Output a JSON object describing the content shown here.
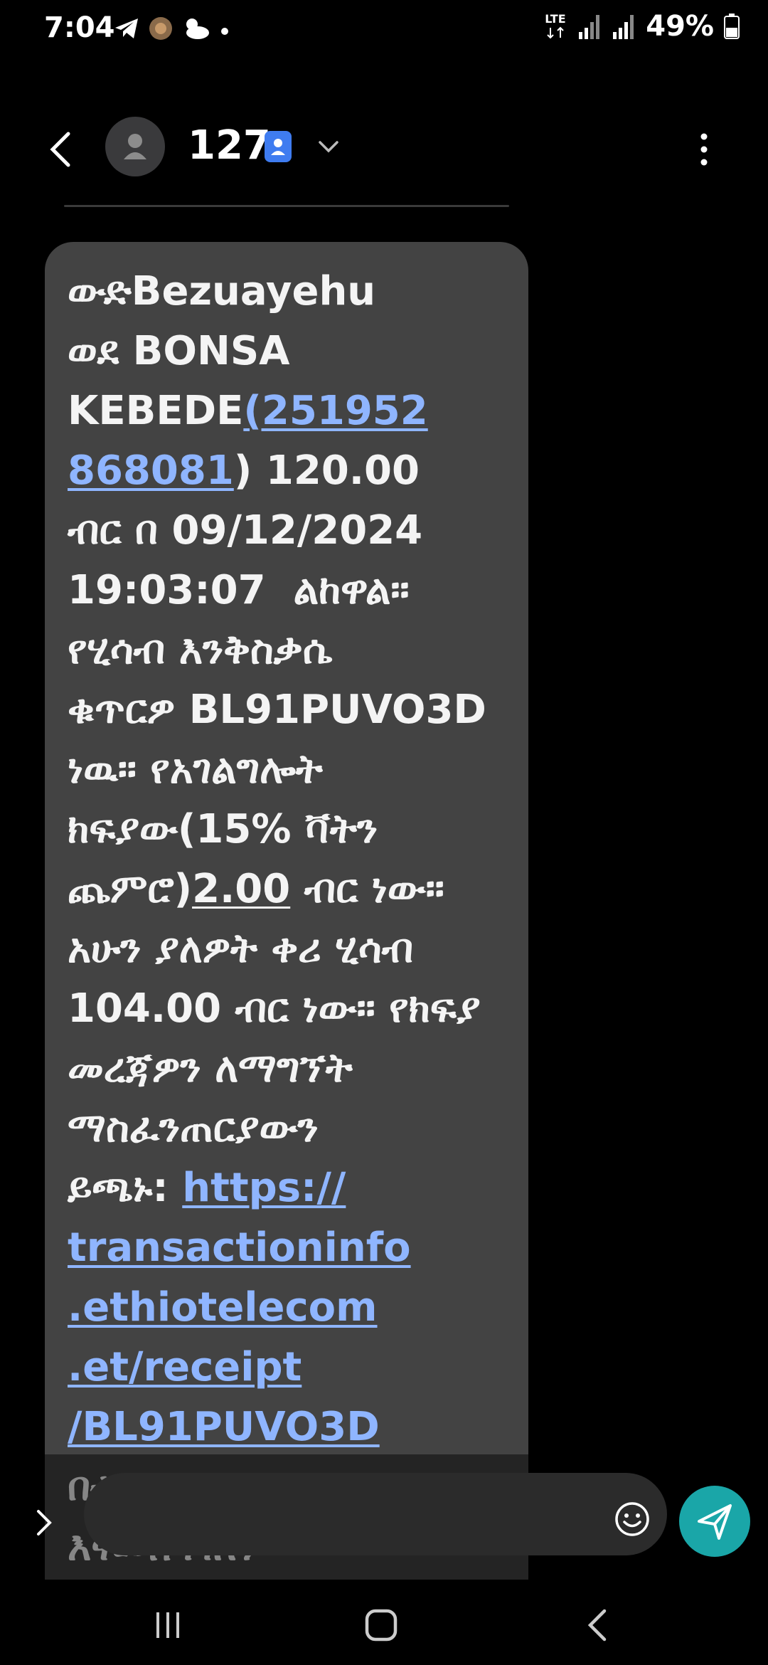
{
  "status_bar": {
    "time": "7:04",
    "network": "LTE",
    "battery": "49%"
  },
  "header": {
    "contact_name": "127",
    "icons": [
      "back-arrow-icon",
      "avatar-icon",
      "contact-badge-icon",
      "chevron-down-icon",
      "more-vert-icon"
    ]
  },
  "message": {
    "segments": [
      {
        "text": "ውድBezuayehu\nወደ BONSA\nKEBEDE",
        "style": "plain"
      },
      {
        "text": "(251952\n868081",
        "style": "link"
      },
      {
        "text": ") 120.00\nብር በ 09/12/2024\n19:03:07  ልከዋል። \nየሂሳብ እንቅስቃሴ\nቁጥርዎ BL91PUVO3D\nነዉ። የአገልግሎት\nክፍያው(15% ቫትን\nጨምሮ)",
        "style": "plain"
      },
      {
        "text": "2.00",
        "style": "underline"
      },
      {
        "text": " ብር ነው። \nአሁን ያለዎት ቀሪ ሂሳብ\n104.00 ብር ነው። የክፍያ\nመረጃዎን ለማግኘት\nማስፈንጠርያውን\nይጫኑ: ",
        "style": "plain"
      },
      {
        "text": "https://\ntransactioninfo\n.ethiotelecom\n.et/receipt\n/BL91PUVO3D",
        "style": "link"
      },
      {
        "text": "\nበቴሌ ብር ስለተገለገሉ\nእናመሰግናለን",
        "style": "plain"
      }
    ]
  },
  "composer": {
    "placeholder": ""
  },
  "nav_bar": {
    "icons": [
      "recent-apps-icon",
      "home-icon",
      "back-icon"
    ]
  },
  "colors": {
    "bubble": "#434343",
    "link": "#8fb5ff",
    "send": "#1aa6a8",
    "badge": "#3f7cf0"
  }
}
